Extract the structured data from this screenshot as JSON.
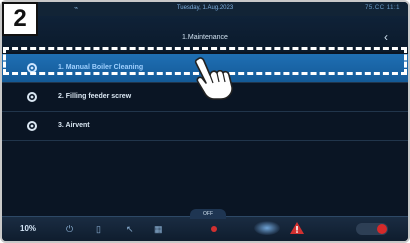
{
  "badge": "2",
  "status_bar": {
    "date": "Tuesday, 1.Aug.2023",
    "right_info": "75.CC 11:1"
  },
  "header": {
    "title": "1.Maintenance",
    "back_icon": "chevron-left-icon"
  },
  "menu": {
    "items": [
      {
        "label": "1. Manual Boiler Cleaning",
        "icon": "gear-icon",
        "selected": true
      },
      {
        "label": "2. Filling feeder screw",
        "icon": "gear-icon",
        "selected": false
      },
      {
        "label": "3. Airvent",
        "icon": "gear-icon",
        "selected": false
      }
    ]
  },
  "bottom_bar": {
    "percent": "10%",
    "off_label": "OFF",
    "icons": [
      "power-icon",
      "device-icon",
      "arrow-icon",
      "grid-icon",
      "alert-dot-icon",
      "warning-icon",
      "toggle-icon"
    ]
  },
  "colors": {
    "selected_row": "#1f6fb4",
    "background": "#0a1524",
    "warning": "#d23030"
  }
}
